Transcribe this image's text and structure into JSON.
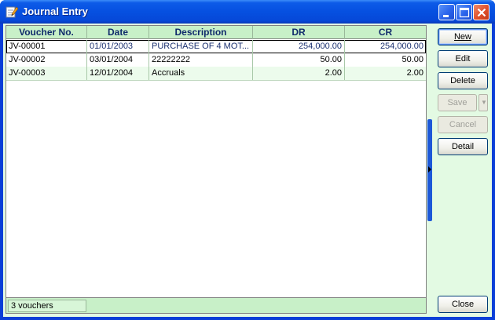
{
  "window": {
    "title": "Journal Entry",
    "icon": "edit-document-icon"
  },
  "titlebar_buttons": [
    "minimize-icon",
    "maximize-icon",
    "close-icon"
  ],
  "grid": {
    "columns": [
      "Voucher No.",
      "Date",
      "Description",
      "DR",
      "CR"
    ],
    "rows": [
      {
        "voucher": "JV-00001",
        "date": "01/01/2003",
        "description": "PURCHASE OF 4 MOT...",
        "dr": "254,000.00",
        "cr": "254,000.00"
      },
      {
        "voucher": "JV-00002",
        "date": "03/01/2004",
        "description": "22222222",
        "dr": "50.00",
        "cr": "50.00"
      },
      {
        "voucher": "JV-00003",
        "date": "12/01/2004",
        "description": "Accruals",
        "dr": "2.00",
        "cr": "2.00"
      }
    ],
    "footer": "3 vouchers"
  },
  "buttons": {
    "new": "New",
    "edit": "Edit",
    "delete": "Delete",
    "save": "Save",
    "cancel": "Cancel",
    "detail": "Detail",
    "close": "Close"
  },
  "colors": {
    "titlebar": "#0650e0",
    "client_bg": "#e3fae3",
    "header_bg": "#c8f0c8",
    "header_text": "#0f2a6b"
  }
}
